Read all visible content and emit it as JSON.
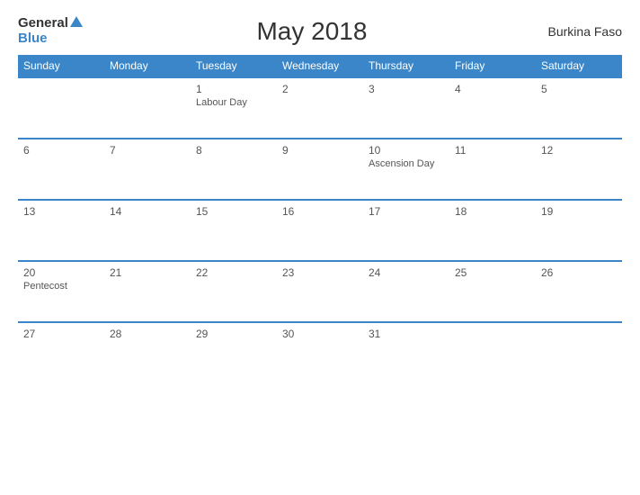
{
  "header": {
    "title": "May 2018",
    "country": "Burkina Faso",
    "logo_general": "General",
    "logo_blue": "Blue"
  },
  "weekdays": [
    "Sunday",
    "Monday",
    "Tuesday",
    "Wednesday",
    "Thursday",
    "Friday",
    "Saturday"
  ],
  "weeks": [
    [
      {
        "day": "",
        "holiday": ""
      },
      {
        "day": "",
        "holiday": ""
      },
      {
        "day": "1",
        "holiday": "Labour Day"
      },
      {
        "day": "2",
        "holiday": ""
      },
      {
        "day": "3",
        "holiday": ""
      },
      {
        "day": "4",
        "holiday": ""
      },
      {
        "day": "5",
        "holiday": ""
      }
    ],
    [
      {
        "day": "6",
        "holiday": ""
      },
      {
        "day": "7",
        "holiday": ""
      },
      {
        "day": "8",
        "holiday": ""
      },
      {
        "day": "9",
        "holiday": ""
      },
      {
        "day": "10",
        "holiday": "Ascension Day"
      },
      {
        "day": "11",
        "holiday": ""
      },
      {
        "day": "12",
        "holiday": ""
      }
    ],
    [
      {
        "day": "13",
        "holiday": ""
      },
      {
        "day": "14",
        "holiday": ""
      },
      {
        "day": "15",
        "holiday": ""
      },
      {
        "day": "16",
        "holiday": ""
      },
      {
        "day": "17",
        "holiday": ""
      },
      {
        "day": "18",
        "holiday": ""
      },
      {
        "day": "19",
        "holiday": ""
      }
    ],
    [
      {
        "day": "20",
        "holiday": "Pentecost"
      },
      {
        "day": "21",
        "holiday": ""
      },
      {
        "day": "22",
        "holiday": ""
      },
      {
        "day": "23",
        "holiday": ""
      },
      {
        "day": "24",
        "holiday": ""
      },
      {
        "day": "25",
        "holiday": ""
      },
      {
        "day": "26",
        "holiday": ""
      }
    ],
    [
      {
        "day": "27",
        "holiday": ""
      },
      {
        "day": "28",
        "holiday": ""
      },
      {
        "day": "29",
        "holiday": ""
      },
      {
        "day": "30",
        "holiday": ""
      },
      {
        "day": "31",
        "holiday": ""
      },
      {
        "day": "",
        "holiday": ""
      },
      {
        "day": "",
        "holiday": ""
      }
    ]
  ]
}
